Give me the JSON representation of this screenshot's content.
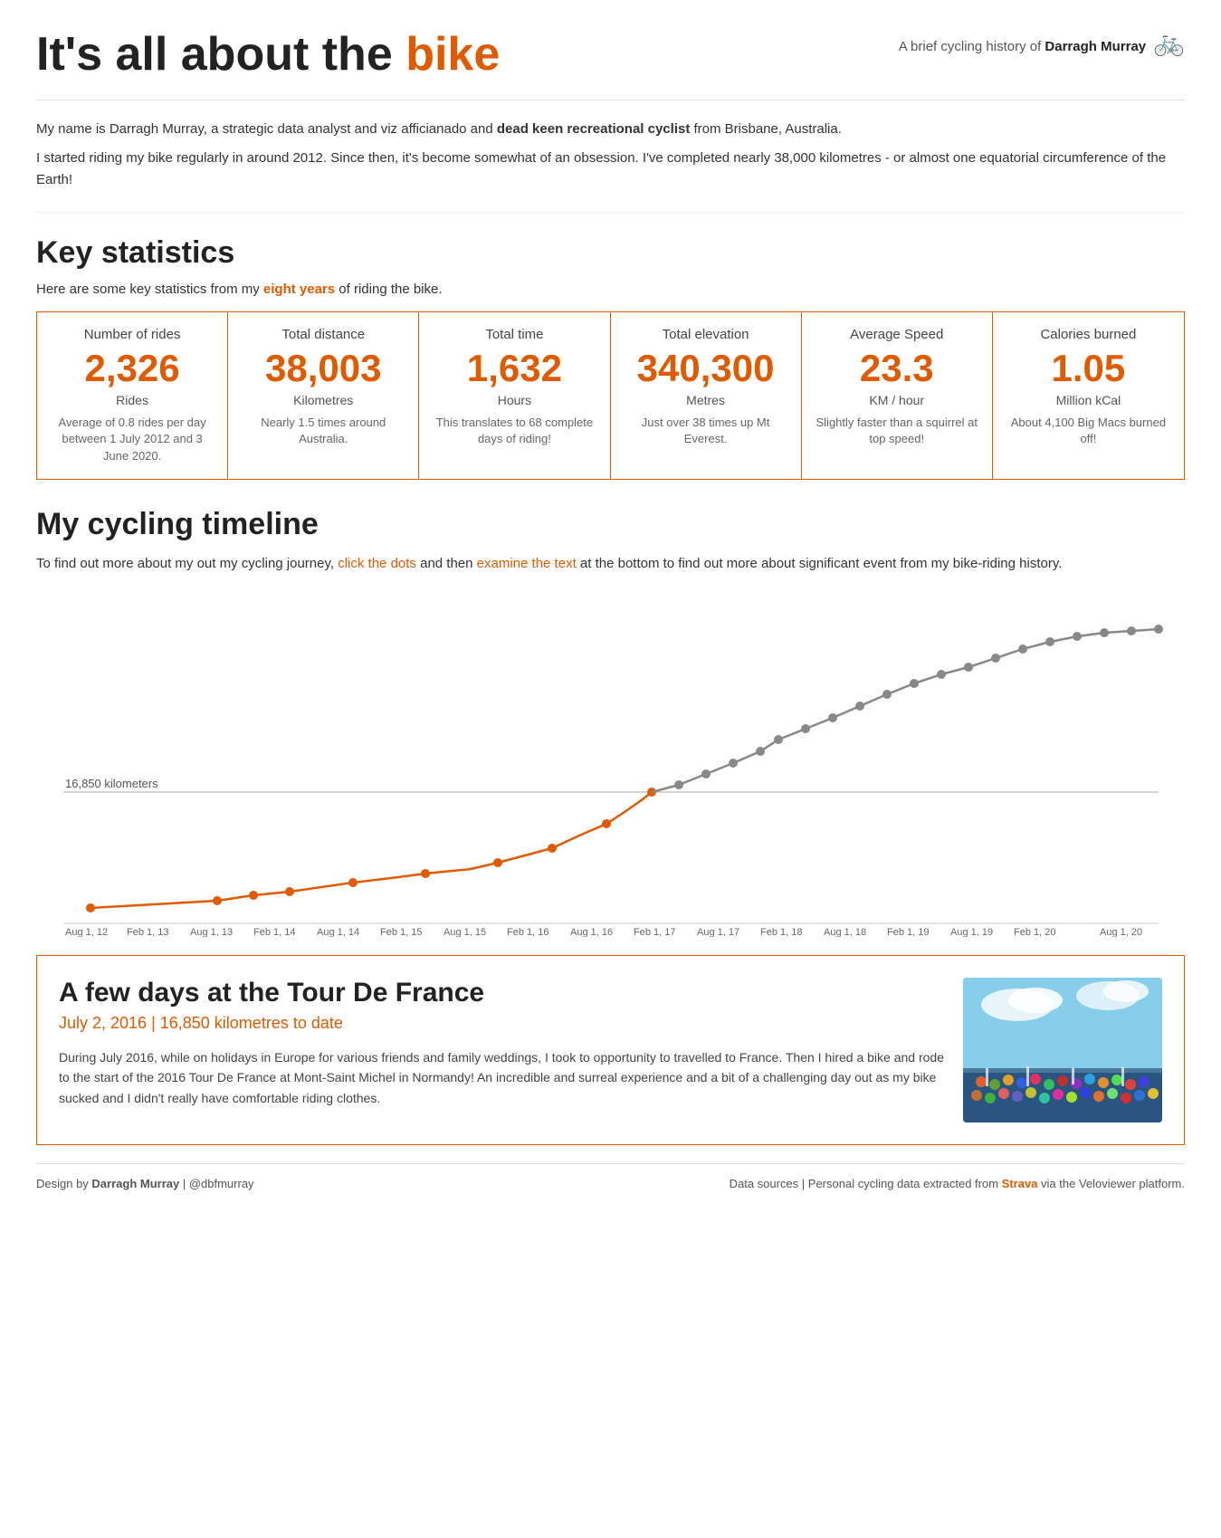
{
  "header": {
    "title_start": "It's all about the ",
    "title_highlight": "bike",
    "subtitle_text": "A brief cycling history of ",
    "subtitle_name": "Darragh Murray",
    "bike_icon": "🚲"
  },
  "intro": {
    "p1": "My name is Darragh Murray, a strategic data analyst and viz afficianado and ",
    "p1_bold": "dead keen recreational cyclist",
    "p1_end": " from Brisbane, Australia.",
    "p2": "I started riding my bike regularly in around 2012. Since then, it's become somewhat of an obsession. I've completed nearly 38,000 kilometres - or almost one equatorial circumference of the Earth!"
  },
  "key_stats": {
    "section_heading": "Key statistics",
    "intro_text_start": "Here are some key statistics from my ",
    "intro_highlight": "eight years",
    "intro_text_end": " of riding the bike.",
    "cards": [
      {
        "label": "Number of rides",
        "value": "2,326",
        "unit": "Rides",
        "desc": "Average of 0.8 rides per day between 1 July 2012 and 3 June 2020."
      },
      {
        "label": "Total distance",
        "value": "38,003",
        "unit": "Kilometres",
        "desc": "Nearly 1.5 times around Australia."
      },
      {
        "label": "Total time",
        "value": "1,632",
        "unit": "Hours",
        "desc": "This translates to 68 complete days of riding!"
      },
      {
        "label": "Total elevation",
        "value": "340,300",
        "unit": "Metres",
        "desc": "Just over 38 times up Mt Everest."
      },
      {
        "label": "Average Speed",
        "value": "23.3",
        "unit": "KM / hour",
        "desc": "Slightly faster than a squirrel at top speed!"
      },
      {
        "label": "Calories burned",
        "value": "1.05",
        "unit": "Million kCal",
        "desc": "About 4,100 Big Macs burned off!"
      }
    ]
  },
  "timeline": {
    "section_heading": "My cycling timeline",
    "intro_start": "To find out more about my out my cycling journey, ",
    "intro_clickable": "click the dots",
    "intro_middle": " and then ",
    "intro_examine": "examine the text",
    "intro_end": " at the bottom to find out more about significant event from my bike-riding history.",
    "reference_line_label": "16,850 kilometers",
    "x_labels": [
      "Aug 1, 12",
      "Feb 1, 13",
      "Aug 1, 13",
      "Feb 1, 14",
      "Aug 1, 14",
      "Feb 1, 15",
      "Aug 1, 15",
      "Feb 1, 16",
      "Aug 1, 16",
      "Feb 1, 17",
      "Aug 1, 17",
      "Feb 1, 18",
      "Aug 1, 18",
      "Feb 1, 19",
      "Aug 1, 19",
      "Feb 1, 20",
      "Aug 1, 20"
    ]
  },
  "event": {
    "title": "A few days at the Tour De France",
    "meta": "July 2, 2016 | 16,850 kilometres to date",
    "text": "During July 2016, while on holidays in Europe for various friends and family weddings, I took to opportunity to travelled to France. Then I hired a bike and rode to the start of the 2016 Tour De France at Mont-Saint Michel in Normandy! An incredible and surreal experience and a bit of a challenging day out as my bike sucked and I didn't really have comfortable riding clothes."
  },
  "footer": {
    "left": "Design by ",
    "left_name": "Darragh Murray",
    "left_handle": " | @dbfmurray",
    "right_start": "Data sources | Personal cycling data extracted from ",
    "right_strava": "Strava",
    "right_end": " via the Veloviewer platform."
  }
}
